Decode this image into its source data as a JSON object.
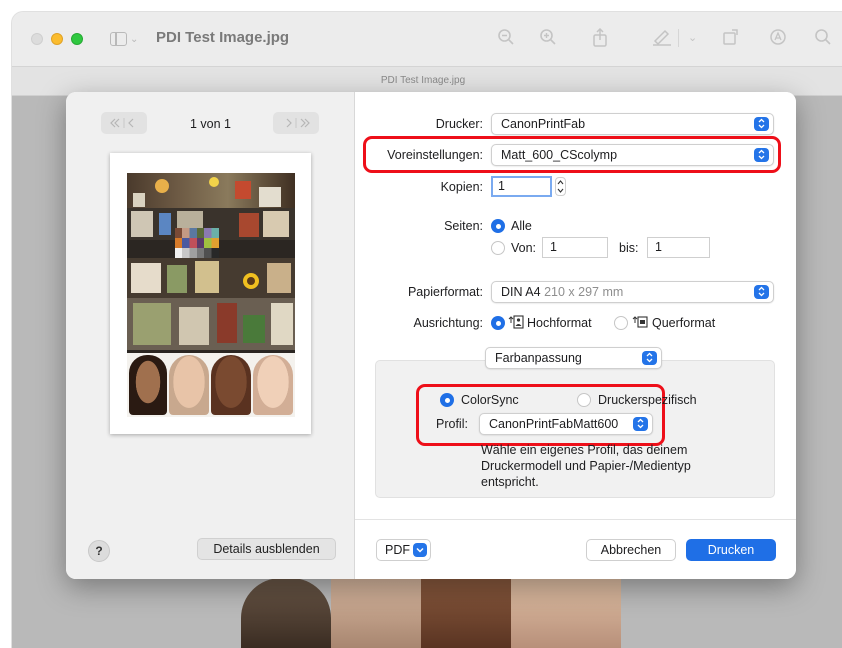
{
  "window": {
    "title": "PDI Test Image.jpg",
    "tab_label": "PDI Test Image.jpg",
    "toolbar_icons": [
      "zoom-out-icon",
      "zoom-in-icon",
      "share-icon",
      "markup-icon",
      "chevron-down-icon",
      "rotate-icon",
      "annotate-icon",
      "search-icon"
    ]
  },
  "preview": {
    "page_counter": "1 von 1",
    "prev_label": "≪ | <",
    "next_label": "> | ≫",
    "help_label": "?",
    "details_button": "Details ausblenden"
  },
  "settings": {
    "printer_label": "Drucker:",
    "printer_value": "CanonPrintFab",
    "presets_label": "Voreinstellungen:",
    "presets_value": "Matt_600_CScolymp",
    "copies_label": "Kopien:",
    "copies_value": "1",
    "pages_label": "Seiten:",
    "pages_all": "Alle",
    "pages_from": "Von:",
    "pages_from_value": "1",
    "pages_to": "bis:",
    "pages_to_value": "1",
    "paper_label": "Papierformat:",
    "paper_value": "DIN A4",
    "paper_size": "210 x 297 mm",
    "orientation_label": "Ausrichtung:",
    "orientation_portrait": "Hochformat",
    "orientation_landscape": "Querformat",
    "section_popup": "Farbanpassung",
    "colorsync_label": "ColorSync",
    "printer_specific_label": "Druckerspezifisch",
    "profile_label": "Profil:",
    "profile_value": "CanonPrintFabMatt600",
    "profile_hint": "Wähle ein eigenes Profil, das deinem Druckermodell und Papier-/Medientyp entspricht."
  },
  "footer": {
    "pdf_label": "PDF",
    "cancel_label": "Abbrechen",
    "print_label": "Drucken"
  },
  "colors": {
    "accent": "#1f6fe6",
    "highlight": "#ee0f19"
  }
}
